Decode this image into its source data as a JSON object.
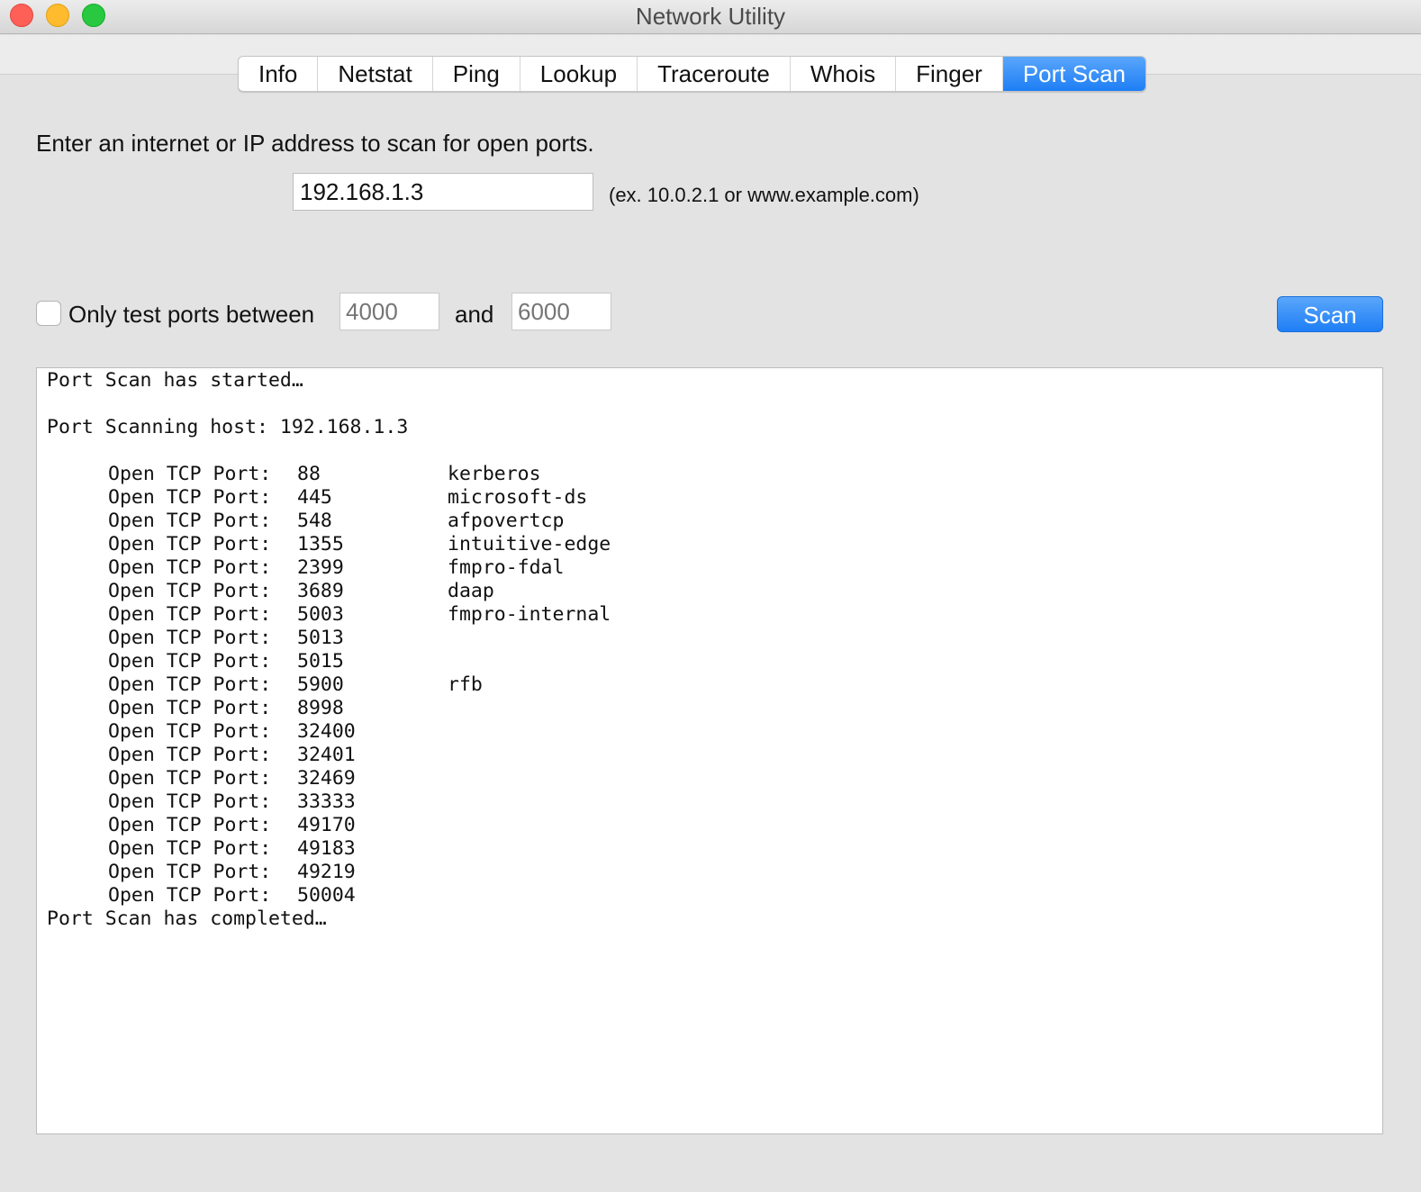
{
  "window": {
    "title": "Network Utility",
    "lights": {
      "close": "#fe5f57",
      "minimize": "#febb2e",
      "zoom": "#28c840"
    }
  },
  "tabs": [
    {
      "label": "Info"
    },
    {
      "label": "Netstat"
    },
    {
      "label": "Ping"
    },
    {
      "label": "Lookup"
    },
    {
      "label": "Traceroute"
    },
    {
      "label": "Whois"
    },
    {
      "label": "Finger"
    },
    {
      "label": "Port Scan",
      "active": true
    }
  ],
  "form": {
    "prompt": "Enter an internet or IP address to scan for open ports.",
    "host_value": "192.168.1.3",
    "host_hint": "(ex. 10.0.2.1 or www.example.com)",
    "range_checkbox_label": "Only test ports between",
    "range_checked": false,
    "range_from_placeholder": "4000",
    "and_label": "and",
    "range_to_placeholder": "6000",
    "scan_button": "Scan"
  },
  "output": {
    "started": "Port Scan has started…",
    "host_line": "Port Scanning host: 192.168.1.3",
    "port_prefix": "Open TCP Port:",
    "ports": [
      {
        "port": "88",
        "service": "kerberos"
      },
      {
        "port": "445",
        "service": "microsoft-ds"
      },
      {
        "port": "548",
        "service": "afpovertcp"
      },
      {
        "port": "1355",
        "service": "intuitive-edge"
      },
      {
        "port": "2399",
        "service": "fmpro-fdal"
      },
      {
        "port": "3689",
        "service": "daap"
      },
      {
        "port": "5003",
        "service": "fmpro-internal"
      },
      {
        "port": "5013",
        "service": ""
      },
      {
        "port": "5015",
        "service": ""
      },
      {
        "port": "5900",
        "service": "rfb"
      },
      {
        "port": "8998",
        "service": ""
      },
      {
        "port": "32400",
        "service": ""
      },
      {
        "port": "32401",
        "service": ""
      },
      {
        "port": "32469",
        "service": ""
      },
      {
        "port": "33333",
        "service": ""
      },
      {
        "port": "49170",
        "service": ""
      },
      {
        "port": "49183",
        "service": ""
      },
      {
        "port": "49219",
        "service": ""
      },
      {
        "port": "50004",
        "service": ""
      }
    ],
    "completed": "Port Scan has completed…"
  }
}
